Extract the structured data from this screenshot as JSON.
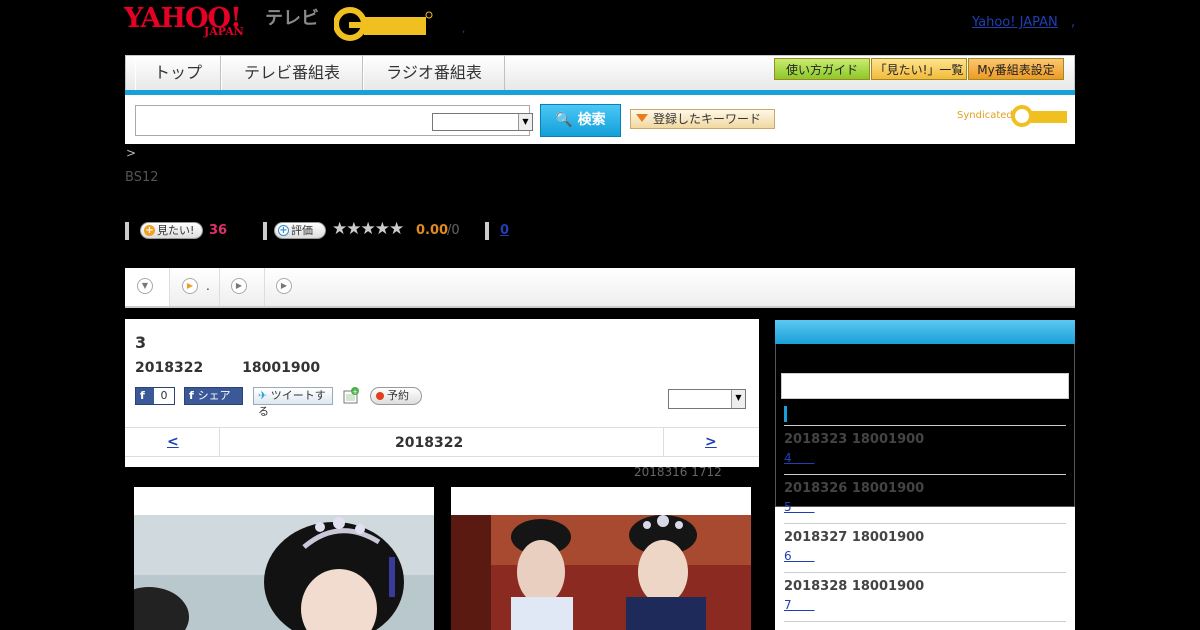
{
  "header": {
    "yahoo_logo_text": "YAHOO!",
    "yahoo_logo_sub": "JAPAN",
    "tv_label": "テレビ",
    "gguide_logo": "G-GUIDE",
    "yahoo_japan_link": "Yahoo! JAPAN",
    "header_dot": ",",
    "mid_dot": ","
  },
  "nav": {
    "tabs": [
      {
        "label": "トップ"
      },
      {
        "label": "テレビ番組表"
      },
      {
        "label": "ラジオ番組表"
      }
    ],
    "guide_buttons": [
      {
        "label": "使い方ガイド",
        "color": "#9cd03a"
      },
      {
        "label": "「見たい!」一覧",
        "color": "#f5c24a"
      },
      {
        "label": "My番組表設定",
        "color": "#f0a030"
      }
    ]
  },
  "search": {
    "input_value": "",
    "select_value": "",
    "button_label": "検索",
    "keyword_button_label": "登録したキーワード",
    "syndicated_label": "Syndicated"
  },
  "breadcrumb": {
    "text": ">"
  },
  "program": {
    "channel": "BS12",
    "want_label": "見たい!",
    "want_count": "36",
    "rate_label": "評価",
    "stars": "★★★★★",
    "score": "0.00",
    "score_den": "/0",
    "review_count": "0"
  },
  "subtabs": {
    "tab2_text": "."
  },
  "episode": {
    "title": "3",
    "air_time": "2018322        18001900",
    "fb_like_label": "",
    "fb_like_count": "0",
    "fb_share_label": "シェア",
    "tweet_label": "ツイートする",
    "reserve_label": "予約",
    "episode_select_value": "",
    "prev_label": "<",
    "date_label": "2018322",
    "next_label": ">",
    "updated": "2018316 1712"
  },
  "sidebar": {
    "items": [
      {
        "date": "2018323  18001900",
        "link": "4      "
      },
      {
        "date": "2018326  18001900",
        "link": "5      "
      },
      {
        "date": "2018327  18001900",
        "link": "6      "
      },
      {
        "date": "2018328  18001900",
        "link": "7      "
      }
    ]
  },
  "colors": {
    "accent_blue": "#1aa0d8",
    "yahoo_red": "#e60026",
    "want_pink": "#e0306a",
    "score_orange": "#e08a20"
  }
}
